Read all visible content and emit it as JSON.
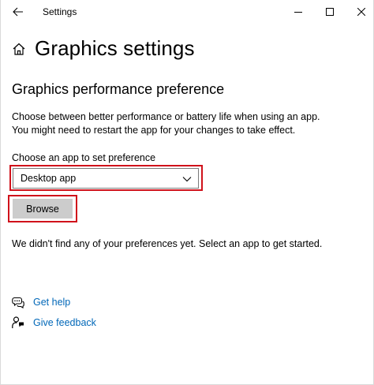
{
  "window": {
    "title": "Settings"
  },
  "header": {
    "page_title": "Graphics settings"
  },
  "section": {
    "title": "Graphics performance preference",
    "description_line1": "Choose between better performance or battery life when using an app.",
    "description_line2": "You might need to restart the app for your changes to take effect."
  },
  "app_picker": {
    "label": "Choose an app to set preference",
    "selected": "Desktop app",
    "browse_label": "Browse"
  },
  "empty_state": "We didn't find any of your preferences yet. Select an app to get started.",
  "links": {
    "help": "Get help",
    "feedback": "Give feedback"
  },
  "colors": {
    "accent_link": "#0067b8",
    "highlight": "#d0121b",
    "button_bg": "#cccccc"
  },
  "icons": {
    "back": "back-arrow-icon",
    "minimize": "minimize-icon",
    "maximize": "maximize-icon",
    "close": "close-icon",
    "home": "home-icon",
    "dropdown": "chevron-down-icon",
    "help": "help-chat-icon",
    "feedback": "feedback-person-icon"
  }
}
